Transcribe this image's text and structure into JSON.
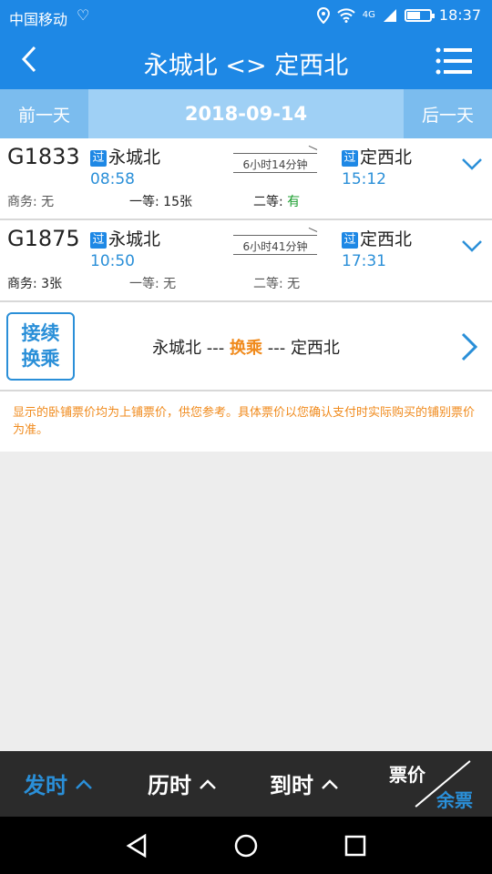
{
  "status": {
    "carrier": "中国移动",
    "signal_label": "4G",
    "time": "18:37",
    "battery_level": 0.6
  },
  "header": {
    "title": "永城北 <> 定西北"
  },
  "datebar": {
    "prev": "前一天",
    "date": "2018-09-14",
    "next": "后一天"
  },
  "trains": [
    {
      "number": "G1833",
      "badge": "过",
      "from_station": "永城北",
      "depart": "08:58",
      "duration": "6小时14分钟",
      "to_station": "定西北",
      "arrive": "15:12",
      "seats": [
        {
          "label": "商务: ",
          "value": "无"
        },
        {
          "label": "一等: ",
          "value": "15张"
        },
        {
          "label": "二等: ",
          "value": "有"
        }
      ]
    },
    {
      "number": "G1875",
      "badge": "过",
      "from_station": "永城北",
      "depart": "10:50",
      "duration": "6小时41分钟",
      "to_station": "定西北",
      "arrive": "17:31",
      "seats": [
        {
          "label": "商务: ",
          "value": "3张"
        },
        {
          "label": "一等: ",
          "value": "无"
        },
        {
          "label": "二等: ",
          "value": "无"
        }
      ]
    }
  ],
  "transfer": {
    "button_line1": "接续",
    "button_line2": "换乘",
    "from": "永城北",
    "sep1": " --- ",
    "mid": "换乘",
    "sep2": " --- ",
    "to": "定西北"
  },
  "notice": "显示的卧铺票价均为上铺票价，供您参考。具体票价以您确认支付时实际购买的铺别票价为准。",
  "sortbar": {
    "depart_time": "发时",
    "duration": "历时",
    "arrive_time": "到时",
    "price": "票价",
    "remaining": "余票"
  },
  "colors": {
    "primary": "#1e88e5",
    "accent": "#f08a1c",
    "available": "#1b9e2f"
  }
}
